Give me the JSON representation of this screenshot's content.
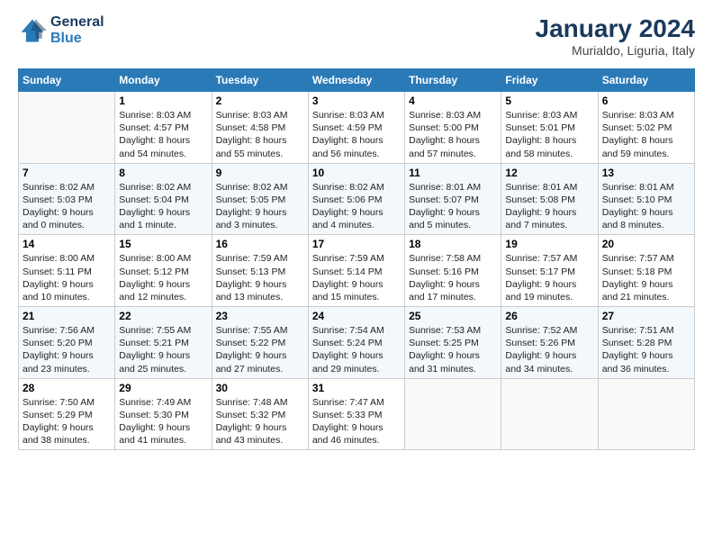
{
  "header": {
    "logo_line1": "General",
    "logo_line2": "Blue",
    "title": "January 2024",
    "subtitle": "Murialdo, Liguria, Italy"
  },
  "columns": [
    "Sunday",
    "Monday",
    "Tuesday",
    "Wednesday",
    "Thursday",
    "Friday",
    "Saturday"
  ],
  "weeks": [
    [
      {
        "num": "",
        "info": ""
      },
      {
        "num": "1",
        "info": "Sunrise: 8:03 AM\nSunset: 4:57 PM\nDaylight: 8 hours\nand 54 minutes."
      },
      {
        "num": "2",
        "info": "Sunrise: 8:03 AM\nSunset: 4:58 PM\nDaylight: 8 hours\nand 55 minutes."
      },
      {
        "num": "3",
        "info": "Sunrise: 8:03 AM\nSunset: 4:59 PM\nDaylight: 8 hours\nand 56 minutes."
      },
      {
        "num": "4",
        "info": "Sunrise: 8:03 AM\nSunset: 5:00 PM\nDaylight: 8 hours\nand 57 minutes."
      },
      {
        "num": "5",
        "info": "Sunrise: 8:03 AM\nSunset: 5:01 PM\nDaylight: 8 hours\nand 58 minutes."
      },
      {
        "num": "6",
        "info": "Sunrise: 8:03 AM\nSunset: 5:02 PM\nDaylight: 8 hours\nand 59 minutes."
      }
    ],
    [
      {
        "num": "7",
        "info": "Sunrise: 8:02 AM\nSunset: 5:03 PM\nDaylight: 9 hours\nand 0 minutes."
      },
      {
        "num": "8",
        "info": "Sunrise: 8:02 AM\nSunset: 5:04 PM\nDaylight: 9 hours\nand 1 minute."
      },
      {
        "num": "9",
        "info": "Sunrise: 8:02 AM\nSunset: 5:05 PM\nDaylight: 9 hours\nand 3 minutes."
      },
      {
        "num": "10",
        "info": "Sunrise: 8:02 AM\nSunset: 5:06 PM\nDaylight: 9 hours\nand 4 minutes."
      },
      {
        "num": "11",
        "info": "Sunrise: 8:01 AM\nSunset: 5:07 PM\nDaylight: 9 hours\nand 5 minutes."
      },
      {
        "num": "12",
        "info": "Sunrise: 8:01 AM\nSunset: 5:08 PM\nDaylight: 9 hours\nand 7 minutes."
      },
      {
        "num": "13",
        "info": "Sunrise: 8:01 AM\nSunset: 5:10 PM\nDaylight: 9 hours\nand 8 minutes."
      }
    ],
    [
      {
        "num": "14",
        "info": "Sunrise: 8:00 AM\nSunset: 5:11 PM\nDaylight: 9 hours\nand 10 minutes."
      },
      {
        "num": "15",
        "info": "Sunrise: 8:00 AM\nSunset: 5:12 PM\nDaylight: 9 hours\nand 12 minutes."
      },
      {
        "num": "16",
        "info": "Sunrise: 7:59 AM\nSunset: 5:13 PM\nDaylight: 9 hours\nand 13 minutes."
      },
      {
        "num": "17",
        "info": "Sunrise: 7:59 AM\nSunset: 5:14 PM\nDaylight: 9 hours\nand 15 minutes."
      },
      {
        "num": "18",
        "info": "Sunrise: 7:58 AM\nSunset: 5:16 PM\nDaylight: 9 hours\nand 17 minutes."
      },
      {
        "num": "19",
        "info": "Sunrise: 7:57 AM\nSunset: 5:17 PM\nDaylight: 9 hours\nand 19 minutes."
      },
      {
        "num": "20",
        "info": "Sunrise: 7:57 AM\nSunset: 5:18 PM\nDaylight: 9 hours\nand 21 minutes."
      }
    ],
    [
      {
        "num": "21",
        "info": "Sunrise: 7:56 AM\nSunset: 5:20 PM\nDaylight: 9 hours\nand 23 minutes."
      },
      {
        "num": "22",
        "info": "Sunrise: 7:55 AM\nSunset: 5:21 PM\nDaylight: 9 hours\nand 25 minutes."
      },
      {
        "num": "23",
        "info": "Sunrise: 7:55 AM\nSunset: 5:22 PM\nDaylight: 9 hours\nand 27 minutes."
      },
      {
        "num": "24",
        "info": "Sunrise: 7:54 AM\nSunset: 5:24 PM\nDaylight: 9 hours\nand 29 minutes."
      },
      {
        "num": "25",
        "info": "Sunrise: 7:53 AM\nSunset: 5:25 PM\nDaylight: 9 hours\nand 31 minutes."
      },
      {
        "num": "26",
        "info": "Sunrise: 7:52 AM\nSunset: 5:26 PM\nDaylight: 9 hours\nand 34 minutes."
      },
      {
        "num": "27",
        "info": "Sunrise: 7:51 AM\nSunset: 5:28 PM\nDaylight: 9 hours\nand 36 minutes."
      }
    ],
    [
      {
        "num": "28",
        "info": "Sunrise: 7:50 AM\nSunset: 5:29 PM\nDaylight: 9 hours\nand 38 minutes."
      },
      {
        "num": "29",
        "info": "Sunrise: 7:49 AM\nSunset: 5:30 PM\nDaylight: 9 hours\nand 41 minutes."
      },
      {
        "num": "30",
        "info": "Sunrise: 7:48 AM\nSunset: 5:32 PM\nDaylight: 9 hours\nand 43 minutes."
      },
      {
        "num": "31",
        "info": "Sunrise: 7:47 AM\nSunset: 5:33 PM\nDaylight: 9 hours\nand 46 minutes."
      },
      {
        "num": "",
        "info": ""
      },
      {
        "num": "",
        "info": ""
      },
      {
        "num": "",
        "info": ""
      }
    ]
  ]
}
